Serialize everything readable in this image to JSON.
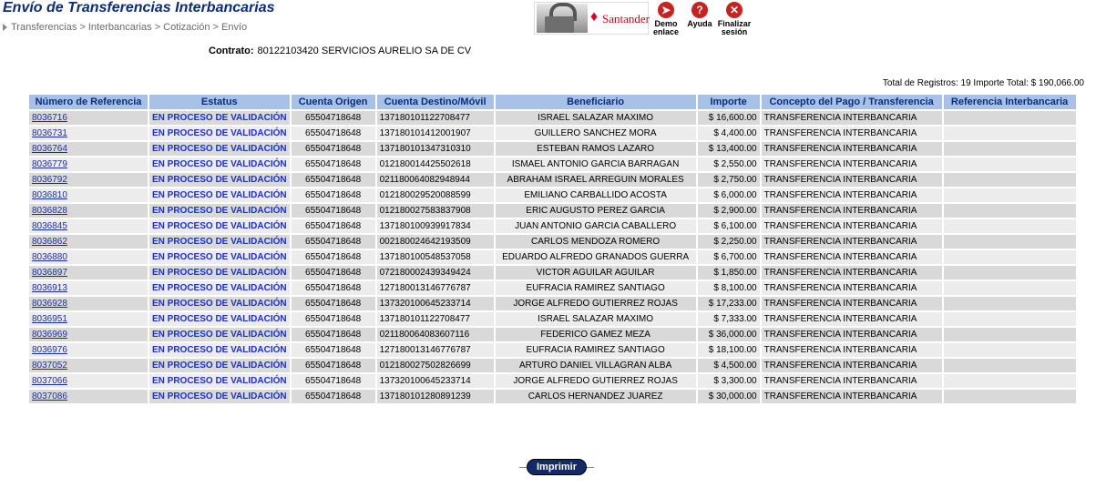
{
  "header": {
    "title": "Envío de Transferencias Interbancarias",
    "breadcrumb": "Transferencias > Interbancarias > Cotización > Envío",
    "brand": "Santander"
  },
  "toolbar": {
    "demo_label": "Demo enlace",
    "help_label": "Ayuda",
    "finish_label": "Finalizar sesión"
  },
  "contract": {
    "label": "Contrato:",
    "value": "80122103420 SERVICIOS AURELIO SA DE CV"
  },
  "totals": {
    "text": "Total de Registros: 19   Importe Total: $ 190,066.00"
  },
  "table": {
    "headers": [
      "Número de Referencia",
      "Estatus",
      "Cuenta Origen",
      "Cuenta Destino/Móvil",
      "Beneficiario",
      "Importe",
      "Concepto del Pago / Transferencia",
      "Referencia Interbancaria"
    ],
    "rows": [
      {
        "ref": "8036716",
        "status": "EN PROCESO DE VALIDACIÓN",
        "origen": "65504718648",
        "destino": "137180101122708477",
        "beneficiario": "ISRAEL SALAZAR MAXIMO",
        "importe": "$ 16,600.00",
        "concepto": "TRANSFERENCIA INTERBANCARIA",
        "ref_inter": ""
      },
      {
        "ref": "8036731",
        "status": "EN PROCESO DE VALIDACIÓN",
        "origen": "65504718648",
        "destino": "137180101412001907",
        "beneficiario": "GUILLERO SANCHEZ MORA",
        "importe": "$ 4,400.00",
        "concepto": "TRANSFERENCIA INTERBANCARIA",
        "ref_inter": ""
      },
      {
        "ref": "8036764",
        "status": "EN PROCESO DE VALIDACIÓN",
        "origen": "65504718648",
        "destino": "137180101347310310",
        "beneficiario": "ESTEBAN RAMOS LAZARO",
        "importe": "$ 13,400.00",
        "concepto": "TRANSFERENCIA INTERBANCARIA",
        "ref_inter": ""
      },
      {
        "ref": "8036779",
        "status": "EN PROCESO DE VALIDACIÓN",
        "origen": "65504718648",
        "destino": "012180014425502618",
        "beneficiario": "ISMAEL ANTONIO GARCIA BARRAGAN",
        "importe": "$ 2,550.00",
        "concepto": "TRANSFERENCIA INTERBANCARIA",
        "ref_inter": ""
      },
      {
        "ref": "8036792",
        "status": "EN PROCESO DE VALIDACIÓN",
        "origen": "65504718648",
        "destino": "021180064082948944",
        "beneficiario": "ABRAHAM ISRAEL ARREGUIN MORALES",
        "importe": "$ 2,750.00",
        "concepto": "TRANSFERENCIA INTERBANCARIA",
        "ref_inter": ""
      },
      {
        "ref": "8036810",
        "status": "EN PROCESO DE VALIDACIÓN",
        "origen": "65504718648",
        "destino": "012180029520088599",
        "beneficiario": "EMILIANO CARBALLIDO ACOSTA",
        "importe": "$ 6,000.00",
        "concepto": "TRANSFERENCIA INTERBANCARIA",
        "ref_inter": ""
      },
      {
        "ref": "8036828",
        "status": "EN PROCESO DE VALIDACIÓN",
        "origen": "65504718648",
        "destino": "012180027583837908",
        "beneficiario": "ERIC AUGUSTO PEREZ GARCIA",
        "importe": "$ 2,900.00",
        "concepto": "TRANSFERENCIA INTERBANCARIA",
        "ref_inter": ""
      },
      {
        "ref": "8036845",
        "status": "EN PROCESO DE VALIDACIÓN",
        "origen": "65504718648",
        "destino": "137180100939917834",
        "beneficiario": "JUAN ANTONIO GARCIA CABALLERO",
        "importe": "$ 6,100.00",
        "concepto": "TRANSFERENCIA INTERBANCARIA",
        "ref_inter": ""
      },
      {
        "ref": "8036862",
        "status": "EN PROCESO DE VALIDACIÓN",
        "origen": "65504718648",
        "destino": "002180024642193509",
        "beneficiario": "CARLOS MENDOZA ROMERO",
        "importe": "$ 2,250.00",
        "concepto": "TRANSFERENCIA INTERBANCARIA",
        "ref_inter": ""
      },
      {
        "ref": "8036880",
        "status": "EN PROCESO DE VALIDACIÓN",
        "origen": "65504718648",
        "destino": "137180100548537058",
        "beneficiario": "EDUARDO ALFREDO GRANADOS GUERRA",
        "importe": "$ 6,700.00",
        "concepto": "TRANSFERENCIA INTERBANCARIA",
        "ref_inter": ""
      },
      {
        "ref": "8036897",
        "status": "EN PROCESO DE VALIDACIÓN",
        "origen": "65504718648",
        "destino": "072180002439349424",
        "beneficiario": "VICTOR AGUILAR AGUILAR",
        "importe": "$ 1,850.00",
        "concepto": "TRANSFERENCIA INTERBANCARIA",
        "ref_inter": ""
      },
      {
        "ref": "8036913",
        "status": "EN PROCESO DE VALIDACIÓN",
        "origen": "65504718648",
        "destino": "127180013146776787",
        "beneficiario": "EUFRACIA RAMIREZ SANTIAGO",
        "importe": "$ 8,100.00",
        "concepto": "TRANSFERENCIA INTERBANCARIA",
        "ref_inter": ""
      },
      {
        "ref": "8036928",
        "status": "EN PROCESO DE VALIDACIÓN",
        "origen": "65504718648",
        "destino": "137320100645233714",
        "beneficiario": "JORGE ALFREDO GUTIERREZ ROJAS",
        "importe": "$ 17,233.00",
        "concepto": "TRANSFERENCIA INTERBANCARIA",
        "ref_inter": ""
      },
      {
        "ref": "8036951",
        "status": "EN PROCESO DE VALIDACIÓN",
        "origen": "65504718648",
        "destino": "137180101122708477",
        "beneficiario": "ISRAEL SALAZAR MAXIMO",
        "importe": "$ 7,333.00",
        "concepto": "TRANSFERENCIA INTERBANCARIA",
        "ref_inter": ""
      },
      {
        "ref": "8036969",
        "status": "EN PROCESO DE VALIDACIÓN",
        "origen": "65504718648",
        "destino": "021180064083607116",
        "beneficiario": "FEDERICO GAMEZ MEZA",
        "importe": "$ 36,000.00",
        "concepto": "TRANSFERENCIA INTERBANCARIA",
        "ref_inter": ""
      },
      {
        "ref": "8036976",
        "status": "EN PROCESO DE VALIDACIÓN",
        "origen": "65504718648",
        "destino": "127180013146776787",
        "beneficiario": "EUFRACIA RAMIREZ SANTIAGO",
        "importe": "$ 18,100.00",
        "concepto": "TRANSFERENCIA INTERBANCARIA",
        "ref_inter": ""
      },
      {
        "ref": "8037052",
        "status": "EN PROCESO DE VALIDACIÓN",
        "origen": "65504718648",
        "destino": "012180027502826699",
        "beneficiario": "ARTURO DANIEL VILLAGRAN ALBA",
        "importe": "$ 4,500.00",
        "concepto": "TRANSFERENCIA INTERBANCARIA",
        "ref_inter": ""
      },
      {
        "ref": "8037066",
        "status": "EN PROCESO DE VALIDACIÓN",
        "origen": "65504718648",
        "destino": "137320100645233714",
        "beneficiario": "JORGE ALFREDO GUTIERREZ ROJAS",
        "importe": "$ 3,300.00",
        "concepto": "TRANSFERENCIA INTERBANCARIA",
        "ref_inter": ""
      },
      {
        "ref": "8037086",
        "status": "EN PROCESO DE VALIDACIÓN",
        "origen": "65504718648",
        "destino": "137180101280891239",
        "beneficiario": "CARLOS HERNANDEZ JUAREZ",
        "importe": "$ 30,000.00",
        "concepto": "TRANSFERENCIA INTERBANCARIA",
        "ref_inter": ""
      }
    ]
  },
  "actions": {
    "print_label": "Imprimir"
  },
  "colors": {
    "title": "#0b2b7c",
    "header_bg": "#a7c2e6",
    "row_odd": "#d9d9d9",
    "row_even": "#ececec",
    "status": "#1a2fd6",
    "link": "#1a2f9c",
    "brand_red": "#e2001a",
    "button": "#12296b"
  },
  "icons": {
    "lock": "lock-icon",
    "demo": "cursor-icon",
    "help": "help-icon",
    "finish": "close-icon"
  }
}
